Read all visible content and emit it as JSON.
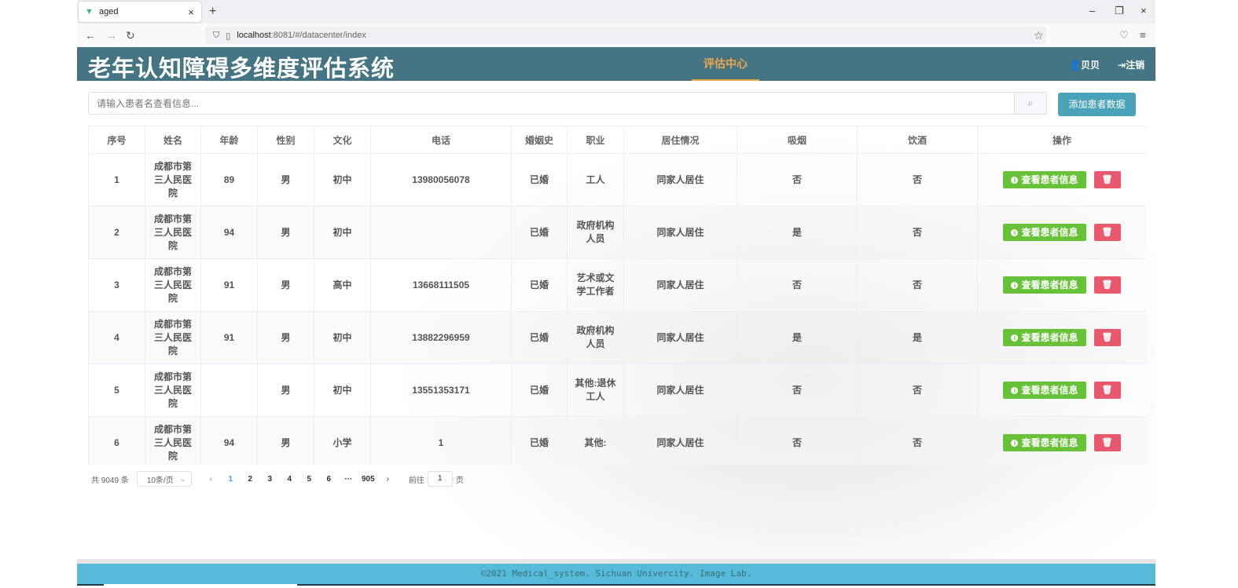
{
  "browser": {
    "tab_title": "aged",
    "tab_close": "×",
    "new_tab": "+",
    "url_host": "localhost",
    "url_path": ":8081/#/datacenter/index",
    "win_min": "–",
    "win_max": "❐",
    "win_close": "×"
  },
  "header": {
    "title": "老年认知障碍多维度评估系统",
    "nav_active": "评估中心",
    "user": "贝贝",
    "logout": "注销"
  },
  "search": {
    "placeholder": "请输入患者名查看信息...",
    "add_button": "添加患者数据"
  },
  "table": {
    "columns": [
      "序号",
      "姓名",
      "年龄",
      "性别",
      "文化",
      "电话",
      "婚姻史",
      "职业",
      "居住情况",
      "吸烟",
      "饮酒",
      "操作"
    ],
    "view_label": "查看患者信息",
    "rows": [
      {
        "no": "1",
        "name": "成都市第三人民医院",
        "age": "89",
        "sex": "男",
        "edu": "初中",
        "phone": "13980056078",
        "marriage": "已婚",
        "job": "工人",
        "living": "同家人居住",
        "smoke": "否",
        "drink": "否"
      },
      {
        "no": "2",
        "name": "成都市第三人民医院",
        "age": "94",
        "sex": "男",
        "edu": "初中",
        "phone": "",
        "marriage": "已婚",
        "job": "政府机构人员",
        "living": "同家人居住",
        "smoke": "是",
        "drink": "否"
      },
      {
        "no": "3",
        "name": "成都市第三人民医院",
        "age": "91",
        "sex": "男",
        "edu": "高中",
        "phone": "13668111505",
        "marriage": "已婚",
        "job": "艺术或文学工作者",
        "living": "同家人居住",
        "smoke": "否",
        "drink": "否"
      },
      {
        "no": "4",
        "name": "成都市第三人民医院",
        "age": "91",
        "sex": "男",
        "edu": "初中",
        "phone": "13882296959",
        "marriage": "已婚",
        "job": "政府机构人员",
        "living": "同家人居住",
        "smoke": "是",
        "drink": "是"
      },
      {
        "no": "5",
        "name": "成都市第三人民医院",
        "age": "",
        "sex": "男",
        "edu": "初中",
        "phone": "13551353171",
        "marriage": "已婚",
        "job": "其他:退休工人",
        "living": "同家人居住",
        "smoke": "否",
        "drink": "否"
      },
      {
        "no": "6",
        "name": "成都市第三人民医院",
        "age": "94",
        "sex": "男",
        "edu": "小学",
        "phone": "1",
        "marriage": "已婚",
        "job": "其他:",
        "living": "同家人居住",
        "smoke": "否",
        "drink": "否"
      }
    ]
  },
  "pagination": {
    "total": "共 9049 条",
    "page_size": "10条/页",
    "pages": [
      "1",
      "2",
      "3",
      "4",
      "5",
      "6",
      "···",
      "905"
    ],
    "current": "1",
    "goto_prefix": "前往",
    "goto_value": "1",
    "goto_suffix": "页"
  },
  "footer": {
    "text": "©2021 Medical_system. Sichuan Univercity. Image Lab."
  },
  "colors": {
    "header_bg": "#457483",
    "accent": "#f0a64a",
    "view_button": "#67c23a",
    "delete_button": "#e8596f",
    "add_button": "#4aa3b8",
    "footer_bg": "#55bbd9"
  }
}
